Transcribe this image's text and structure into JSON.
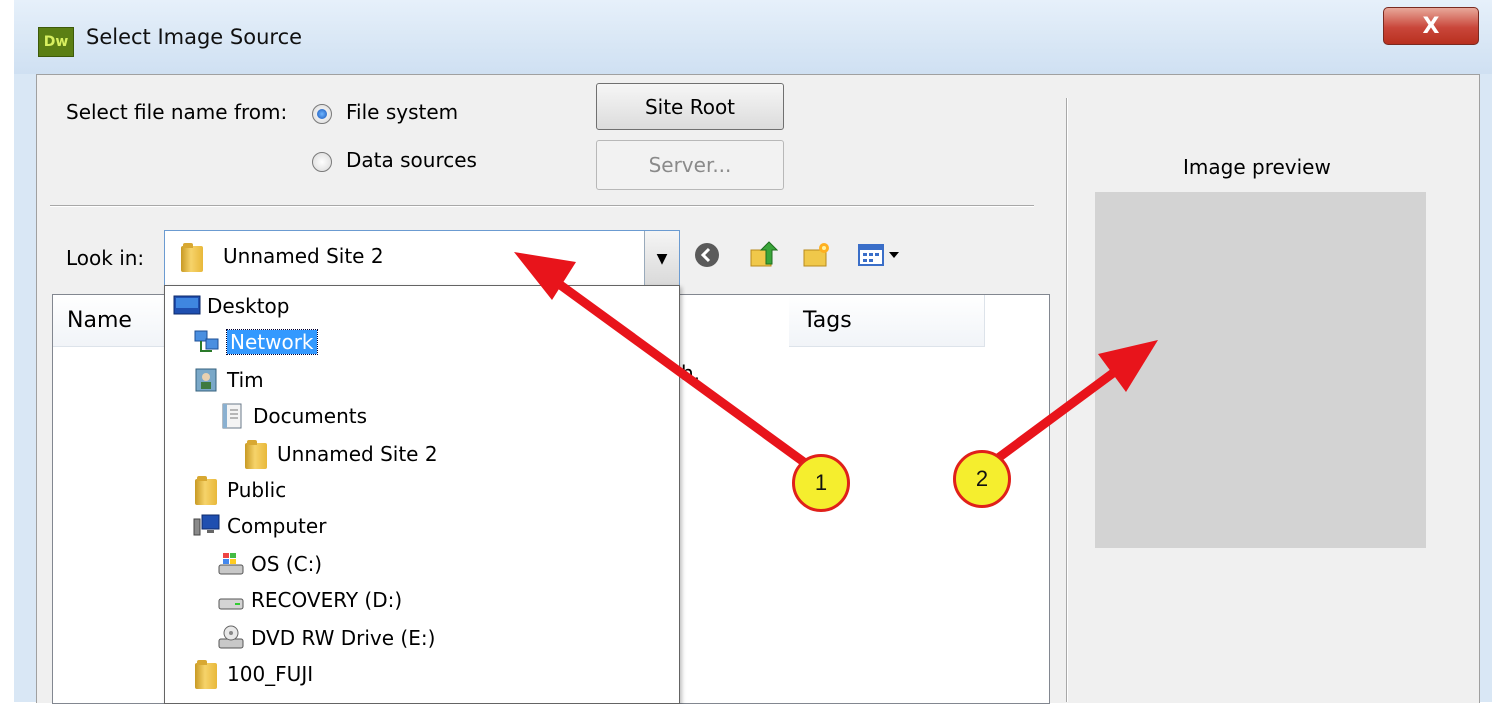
{
  "window": {
    "app_icon_text": "Dw",
    "title": "Select Image Source",
    "close_label": "X"
  },
  "source": {
    "label": "Select file name from:",
    "options": [
      {
        "label": "File system",
        "selected": true
      },
      {
        "label": "Data sources",
        "selected": false
      }
    ]
  },
  "buttons": {
    "site_root": "Site Root",
    "server": "Server..."
  },
  "look_in": {
    "label": "Look in:",
    "value": "Unnamed Site 2"
  },
  "toolbar_icons": [
    "back-icon",
    "up-folder-icon",
    "new-folder-icon",
    "view-menu-icon"
  ],
  "file_list": {
    "columns": [
      "Name",
      "Tags"
    ],
    "partial_text": "h."
  },
  "look_in_dropdown": {
    "items": [
      {
        "label": "Desktop",
        "icon": "desktop-icon",
        "level": 0
      },
      {
        "label": "Network",
        "icon": "network-icon",
        "level": 1,
        "selected": true
      },
      {
        "label": "Tim",
        "icon": "user-icon",
        "level": 1
      },
      {
        "label": "Documents",
        "icon": "documents-icon",
        "level": 2
      },
      {
        "label": "Unnamed Site 2",
        "icon": "folder-icon",
        "level": 3
      },
      {
        "label": "Public",
        "icon": "folder-icon",
        "level": 1
      },
      {
        "label": "Computer",
        "icon": "computer-icon",
        "level": 1
      },
      {
        "label": "OS (C:)",
        "icon": "windows-drive-icon",
        "level": 2
      },
      {
        "label": "RECOVERY (D:)",
        "icon": "drive-icon",
        "level": 2
      },
      {
        "label": "DVD RW Drive (E:)",
        "icon": "dvd-drive-icon",
        "level": 2
      },
      {
        "label": "100_FUJI",
        "icon": "folder-icon",
        "level": 1
      }
    ]
  },
  "preview": {
    "label": "Image preview"
  },
  "callouts": [
    "1",
    "2"
  ],
  "colors": {
    "selection": "#3399ff",
    "arrow": "#e8141b",
    "callout_fill": "#f5ee2e"
  }
}
